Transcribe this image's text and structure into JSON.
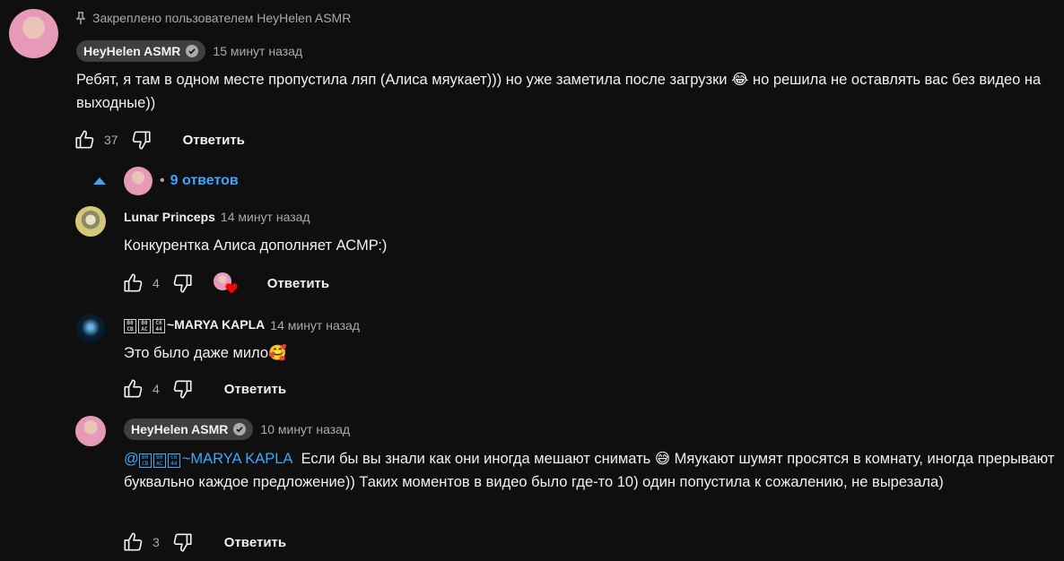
{
  "pinned": {
    "pin_label": "Закреплено пользователем HeyHelen ASMR",
    "author": "HeyHelen ASMR",
    "time": "15 минут назад",
    "text": "Ребят, я там в одном месте пропустила ляп (Алиса мяукает))) но уже заметила после загрузки 😂  но решила не оставлять вас без видео на выходные))",
    "likes": "37",
    "reply_label": "Ответить"
  },
  "replies_toggle": {
    "separator": "•",
    "label": "9 ответов"
  },
  "replies": [
    {
      "author": "Lunar Princeps",
      "time": "14 минут назад",
      "text": "Конкурентка Алиса дополняет АСМР:)",
      "likes": "4",
      "reply_label": "Ответить",
      "creator_heart": true
    },
    {
      "author_prefix": "~MARYA KAPLA",
      "time": "14 минут назад",
      "text": "Это было даже мило🥰",
      "likes": "4",
      "reply_label": "Ответить"
    },
    {
      "author": "HeyHelen ASMR",
      "time": "10 минут назад",
      "mention": "~MARYA KAPLA",
      "text": "Если бы вы знали как они иногда мешают снимать 😅  Мяукают шумят просятся в комнату, иногда прерывают буквально каждое предложение)) Таких моментов в видео было где-то 10) один попустила к сожалению, не вырезала)",
      "likes": "3",
      "reply_label": "Ответить"
    }
  ],
  "colors": {
    "background": "#0f0f0f",
    "link": "#3ea6ff",
    "muted": "#aaaaaa",
    "chip": "#3f3f3f",
    "heart": "#ff0000"
  }
}
